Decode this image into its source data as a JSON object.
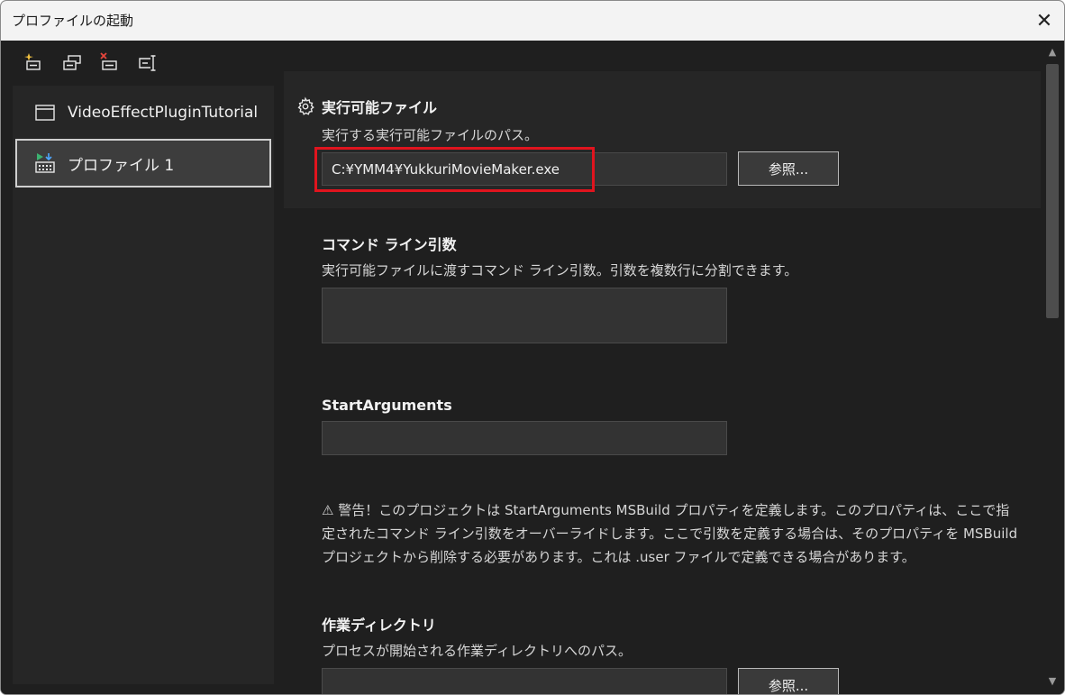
{
  "window": {
    "title": "プロファイルの起動",
    "close_label": "✕"
  },
  "toolbar": {
    "icons": [
      "new-profile-icon",
      "duplicate-profile-icon",
      "delete-profile-icon",
      "rename-profile-icon"
    ]
  },
  "profiles": [
    {
      "label": "VideoEffectPluginTutorial",
      "icon": "window-icon",
      "selected": false
    },
    {
      "label": "プロファイル 1",
      "icon": "executable-profile-icon",
      "selected": true
    }
  ],
  "executable": {
    "heading": "実行可能ファイル",
    "description": "実行する実行可能ファイルのパス。",
    "value": "C:¥YMM4¥YukkuriMovieMaker.exe",
    "browse_label": "参照..."
  },
  "command_line": {
    "heading": "コマンド ライン引数",
    "description": "実行可能ファイルに渡すコマンド ライン引数。引数を複数行に分割できます。",
    "value": ""
  },
  "start_arguments": {
    "heading": "StartArguments",
    "value": ""
  },
  "warning": {
    "lines": [
      "⚠ 警告！このプロジェクトは StartArguments MSBuild プロパティを定義します。このプロパティは、ここで指",
      "定されたコマンド ライン引数をオーバーライドします。ここで引数を定義する場合は、そのプロパティを MSBuild",
      "プロジェクトから削除する必要があります。これは .user ファイルで定義できる場合があります。"
    ]
  },
  "working_directory": {
    "heading": "作業ディレクトリ",
    "description": "プロセスが開始される作業ディレクトリへのパス。",
    "value": "",
    "browse_label": "参照..."
  },
  "colors": {
    "highlight": "#e0141e",
    "panel": "#262626",
    "background": "#1f1f1f"
  }
}
